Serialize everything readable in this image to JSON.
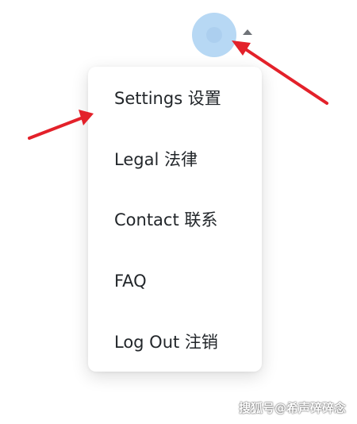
{
  "avatar": {
    "icon": "user-avatar-icon",
    "color": "#b7d8f4"
  },
  "toggle": {
    "icon": "caret-up-icon",
    "color": "#6f7378"
  },
  "menu": {
    "items": [
      {
        "label": "Settings 设置"
      },
      {
        "label": "Legal 法律"
      },
      {
        "label": "Contact 联系"
      },
      {
        "label": "FAQ"
      },
      {
        "label": "Log Out 注销"
      }
    ]
  },
  "annotations": {
    "arrow_color": "#e3212a"
  },
  "watermark": {
    "text": "搜狐号@希声碎碎念"
  }
}
